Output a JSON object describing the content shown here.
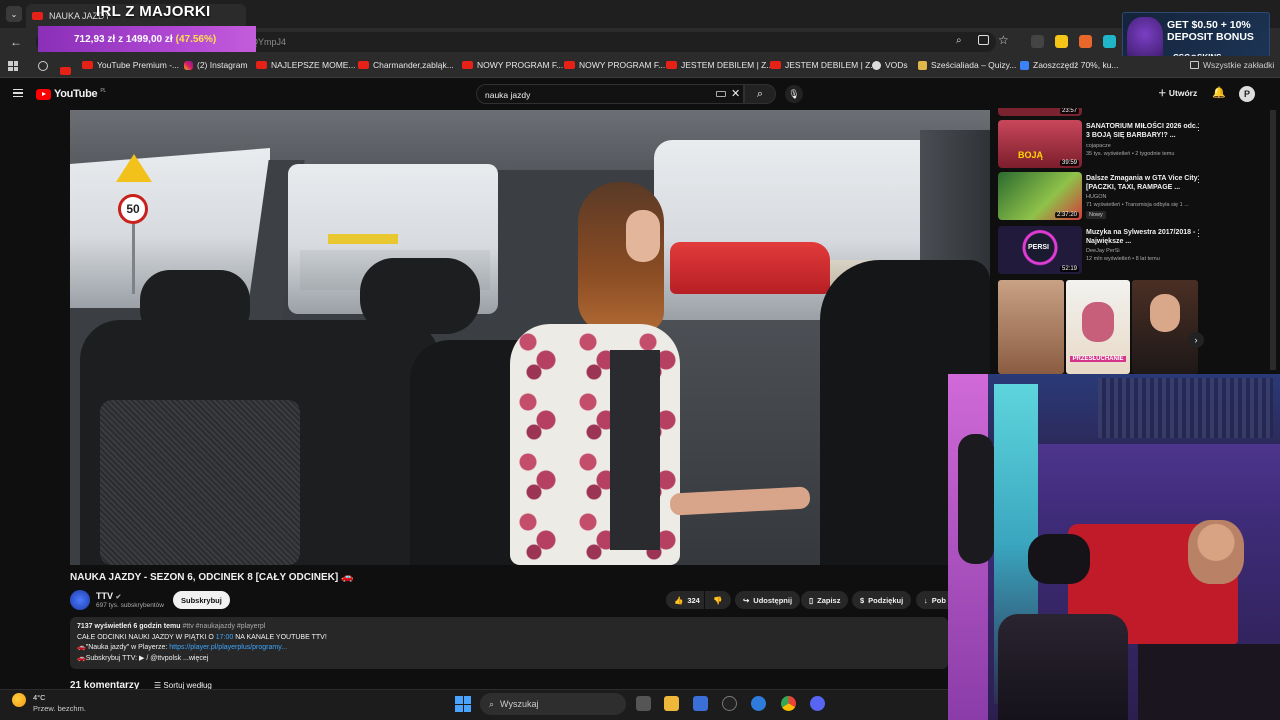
{
  "browser": {
    "tab_title": "NAUKA JAZDY",
    "stream_overlay_title": "IRL Z MAJORKI",
    "url_fragment": "hl5YbQYmpJ4",
    "donation": {
      "amount": "712,93 zł",
      "of": "z 1499,00 zł",
      "percent": "(47.56%)"
    },
    "bookmarks": [
      "YouTube Premium -...",
      "(2) Instagram",
      "NAJLEPSZE MOME...",
      "Charmander,zabląk...",
      "NOWY PROGRAM F...",
      "NOWY PROGRAM F...",
      "JESTEM DEBILEM | Z...",
      "JESTEM DEBILEM | Z...",
      "VODs",
      "Sześcialiada – Quizy...",
      "Zaoszczędź 70%, ku...",
      "Wszystkie zakładki"
    ],
    "ad": {
      "line1": "GET $0.50 + 10%",
      "line2": "DEPOSIT BONUS",
      "brand": "CSG⊙SKINS"
    }
  },
  "youtube": {
    "logo_text": "YouTube",
    "region": "PL",
    "search_query": "nauka jazdy",
    "create_label": "Utwórz",
    "profile_initial": "P"
  },
  "video": {
    "title": "NAUKA JAZDY - SEZON 6, ODCINEK 8 [CAŁY ODCINEK]",
    "sign_speed": "50",
    "channel": "TTV",
    "subs": "697 tys. subskrybentów",
    "subscribe_label": "Subskrybuj",
    "likes": "324",
    "share_label": "Udostępnij",
    "save_label": "Zapisz",
    "thanks_label": "Podziękuj",
    "download_label": "Pob",
    "desc_views": "7137 wyświetleń  6 godzin temu",
    "desc_tags": "#ttv #naukajazdy #playerpl",
    "desc_line1_a": "CAŁE ODCINKI NAUKI JAZDY W PIĄTKI O ",
    "desc_line1_time": "17:00",
    "desc_line1_b": " NA KANALE YOUTUBE TTV!",
    "desc_line2_a": "🚗\"Nauka jazdy\" w Playerze: ",
    "desc_line2_link": "https://player.pl/playerplus/programy...",
    "desc_line3": "🚗Subskrybuj TTV:  ▶ / @ttvpolsk  ...więcej",
    "comments_count": "21 komentarzy",
    "sort_label": "Sortuj według"
  },
  "sidebar": {
    "items": [
      {
        "title": "SANATORIUM MIŁOŚCI 2026 odc. 3 BOJĄ SIĘ BARBARY!? ...",
        "channel": "cojapacze",
        "meta": "35 tys. wyświetleń • 2 tygodnie temu",
        "duration": "39:59",
        "thumb_text": "BOJĄ"
      },
      {
        "title": "Dalsze Zmagania w GTA Vice City [PACZKI, TAXI, RAMPAGE ...",
        "channel": "HUGON",
        "meta": "71 wyświetleń • Transmisja odbyła się 1 ...",
        "duration": "2:37:20",
        "badge": "Nowy"
      },
      {
        "title": "Muzyka na Sylwestra 2017/2018 - Największe ...",
        "channel": "DeeJay PerSi",
        "meta": "12 mln wyświetleń • 8 lat temu",
        "duration": "52:19",
        "thumb_text": "PERSI"
      }
    ],
    "top_duration": "23:57",
    "shelf_label": "PRZESŁUCHANIE"
  },
  "taskbar": {
    "temp": "4°C",
    "weather": "Przew. bezchm.",
    "search_placeholder": "Wyszukaj"
  }
}
